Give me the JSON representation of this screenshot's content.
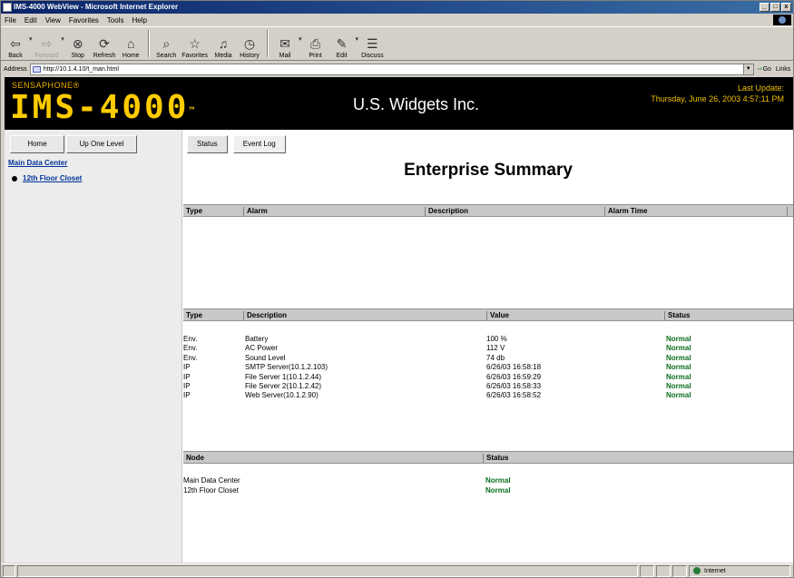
{
  "window": {
    "title": "IMS-4000 WebView - Microsoft Internet Explorer",
    "controls": [
      "_",
      "□",
      "x"
    ]
  },
  "menu": [
    "File",
    "Edit",
    "View",
    "Favorites",
    "Tools",
    "Help"
  ],
  "toolbar": [
    {
      "label": "Back",
      "icon": "back-arrow-icon",
      "glyph": "⇦",
      "enabled": true
    },
    {
      "label": "Forward",
      "icon": "forward-arrow-icon",
      "glyph": "⇨",
      "enabled": false
    },
    {
      "label": "Stop",
      "icon": "stop-icon",
      "glyph": "⊗",
      "enabled": true
    },
    {
      "label": "Refresh",
      "icon": "refresh-icon",
      "glyph": "⟳",
      "enabled": true
    },
    {
      "label": "Home",
      "icon": "home-icon",
      "glyph": "⌂",
      "enabled": true
    },
    {
      "label": "Search",
      "icon": "search-icon",
      "glyph": "⌕",
      "enabled": true
    },
    {
      "label": "Favorites",
      "icon": "favorites-icon",
      "glyph": "☆",
      "enabled": true
    },
    {
      "label": "Media",
      "icon": "media-icon",
      "glyph": "♫",
      "enabled": true
    },
    {
      "label": "History",
      "icon": "history-icon",
      "glyph": "◷",
      "enabled": true
    },
    {
      "label": "Mail",
      "icon": "mail-icon",
      "glyph": "✉",
      "enabled": true
    },
    {
      "label": "Print",
      "icon": "print-icon",
      "glyph": "⎙",
      "enabled": true
    },
    {
      "label": "Edit",
      "icon": "edit-icon",
      "glyph": "✎",
      "enabled": true
    },
    {
      "label": "Discuss",
      "icon": "discuss-icon",
      "glyph": "☰",
      "enabled": true
    }
  ],
  "address": {
    "label": "Address",
    "url": "http://10.1.4.10/t_man.html",
    "go": "Go",
    "links": "Links"
  },
  "banner": {
    "brand_small": "SENSAPHONE®",
    "brand_big": "IMS-4000",
    "brand_tm": "™",
    "company": "U.S. Widgets Inc.",
    "last_update_label": "Last Update:",
    "last_update_value": "Thursday, June 26, 2003 4:57:11 PM"
  },
  "sidebar": {
    "home": "Home",
    "up": "Up One Level",
    "root": "Main Data Center",
    "child": "12th Floor Closet"
  },
  "tabs": [
    "Status",
    "Event Log"
  ],
  "page_title": "Enterprise Summary",
  "alarms_table": {
    "headers": [
      "Type",
      "Alarm",
      "Description",
      "Alarm Time"
    ],
    "rows": []
  },
  "status_table": {
    "headers": [
      "Type",
      "Description",
      "Value",
      "Status"
    ],
    "rows": [
      {
        "type": "Env.",
        "description": "Battery",
        "value": "100 %",
        "status": "Normal"
      },
      {
        "type": "Env.",
        "description": "AC Power",
        "value": "112 V",
        "status": "Normal"
      },
      {
        "type": "Env.",
        "description": "Sound Level",
        "value": "74 db",
        "status": "Normal"
      },
      {
        "type": "IP",
        "description": "SMTP Server(10.1.2.103)",
        "value": "6/26/03 16:58:18",
        "status": "Normal"
      },
      {
        "type": "IP",
        "description": "File Server 1(10.1.2.44)",
        "value": "6/26/03 16:59:29",
        "status": "Normal"
      },
      {
        "type": "IP",
        "description": "File Server 2(10.1.2.42)",
        "value": "6/26/03 16:58:33",
        "status": "Normal"
      },
      {
        "type": "IP",
        "description": "Web Server(10.1.2.90)",
        "value": "6/26/03 16:58:52",
        "status": "Normal"
      }
    ]
  },
  "node_table": {
    "headers": [
      "Node",
      "Status"
    ],
    "rows": [
      {
        "node": "Main Data Center",
        "status": "Normal"
      },
      {
        "node": "12th Floor Closet",
        "status": "Normal"
      }
    ]
  },
  "statusbar": {
    "zone": "Internet"
  },
  "colors": {
    "brand": "#ffcc00",
    "normal_status": "#0a6e1f",
    "link": "#003399",
    "titlebar": "#0a246a"
  }
}
